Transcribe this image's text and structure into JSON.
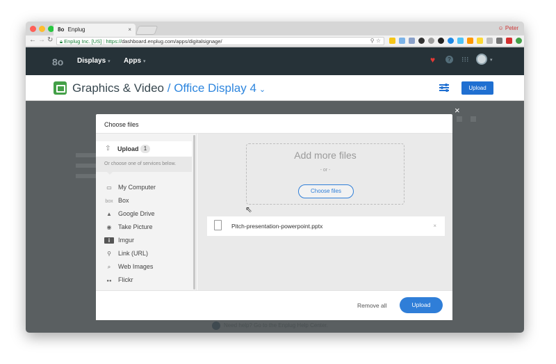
{
  "browser": {
    "tab_title": "Enplug",
    "favicon": "8o",
    "tab_close": "×",
    "profile_name": "Peter",
    "url_origin": "Enplug Inc. [US]",
    "url_scheme": "https://",
    "url_path": "dashboard.enplug.com/apps/digitalsignage/",
    "traffic_colors": [
      "#ff5f57",
      "#febc2e",
      "#28c840"
    ]
  },
  "app_header": {
    "logo": "8o",
    "nav_displays": "Displays",
    "nav_apps": "Apps"
  },
  "title_bar": {
    "app_name": "Graphics & Video",
    "separator": "/",
    "display_name": "Office Display 4",
    "upload_label": "Upload"
  },
  "modal": {
    "title": "Choose files",
    "close": "×",
    "upload_label": "Upload",
    "upload_count": "1",
    "services_hint": "Or choose one of services below.",
    "services": [
      {
        "label": "My Computer",
        "icon": "▭"
      },
      {
        "label": "Box",
        "icon": "box"
      },
      {
        "label": "Google Drive",
        "icon": "▲"
      },
      {
        "label": "Take Picture",
        "icon": "◉"
      },
      {
        "label": "Imgur",
        "icon": "i"
      },
      {
        "label": "Link (URL)",
        "icon": "⚲"
      },
      {
        "label": "Web Images",
        "icon": "⌕"
      },
      {
        "label": "Flickr",
        "icon": "●●"
      }
    ],
    "drop_title": "Add more files",
    "drop_or": "- or -",
    "choose_files": "Choose files",
    "file_name": "Pitch-presentation-powerpoint.pptx",
    "file_remove": "×",
    "remove_all": "Remove all",
    "upload_button": "Upload"
  },
  "footer": {
    "help_text": "Need help? Go to the Enplug Help Center."
  },
  "colors": {
    "accent": "#2f7ed8",
    "app_bar": "#263238",
    "app_icon": "#43a047"
  }
}
